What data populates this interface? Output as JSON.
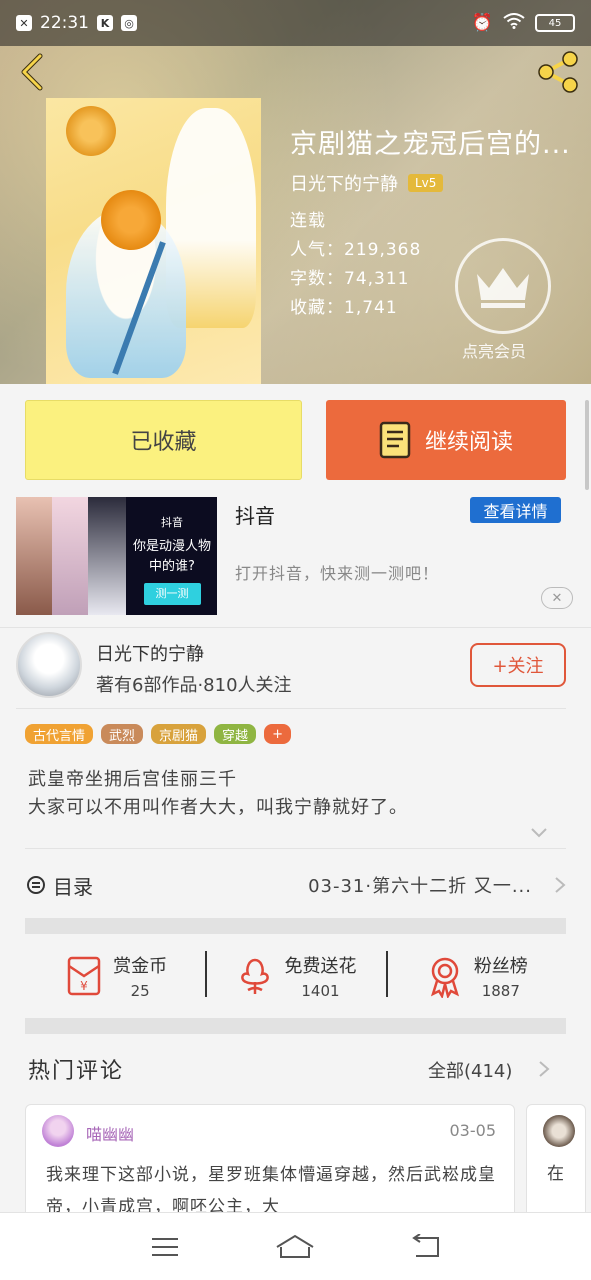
{
  "status_bar": {
    "time": "22:31",
    "battery": "45"
  },
  "book": {
    "title": "京剧猫之宠冠后宫的...",
    "author": "日光下的宁静",
    "level": "Lv5",
    "status": "连载",
    "popularity": "人气：219,368",
    "word_count": "字数：74,311",
    "favorites": "收藏：1,741",
    "vip_label": "点亮会员"
  },
  "actions": {
    "favorited_label": "已收藏",
    "continue_label": "继续阅读"
  },
  "ad": {
    "title": "抖音",
    "detail_button": "查看详情",
    "description": "打开抖音，快来测一测吧！",
    "image_brand": "抖音",
    "image_text": "你是动漫人物中的谁?",
    "image_cta": "测一测"
  },
  "author_card": {
    "name": "日光下的宁静",
    "stats": "著有6部作品·810人关注",
    "follow_label": "+关注"
  },
  "tags": [
    {
      "label": "古代言情",
      "color": "#f0a233"
    },
    {
      "label": "武烈",
      "color": "#c98a5a"
    },
    {
      "label": "京剧猫",
      "color": "#d8a23c"
    },
    {
      "label": "穿越",
      "color": "#8fb542"
    },
    {
      "label": "+",
      "color": "#ec6a3d"
    }
  ],
  "intro": {
    "line1": "武皇帝坐拥后宫佳丽三千",
    "line2": "大家可以不用叫作者大大，叫我宁静就好了。"
  },
  "toc": {
    "label": "目录",
    "latest": "03-31·第六十二折 又一..."
  },
  "rewards": [
    {
      "label": "赏金币",
      "value": "25",
      "icon": "red-envelope-icon"
    },
    {
      "label": "免费送花",
      "value": "1401",
      "icon": "flower-icon"
    },
    {
      "label": "粉丝榜",
      "value": "1887",
      "icon": "medal-icon"
    }
  ],
  "comments": {
    "title": "热门评论",
    "all_label": "全部(414)",
    "items": [
      {
        "user": "喵幽幽",
        "date": "03-05",
        "body": "我来理下这部小说，星罗班集体懵逼穿越，然后武崧成皇帝，小青成宫，啊呸公主，大"
      },
      {
        "body": "在"
      }
    ]
  },
  "colors": {
    "accent_orange": "#ec6a3d",
    "fav_yellow": "#fbf17f",
    "link_blue": "#1f6fd0"
  }
}
